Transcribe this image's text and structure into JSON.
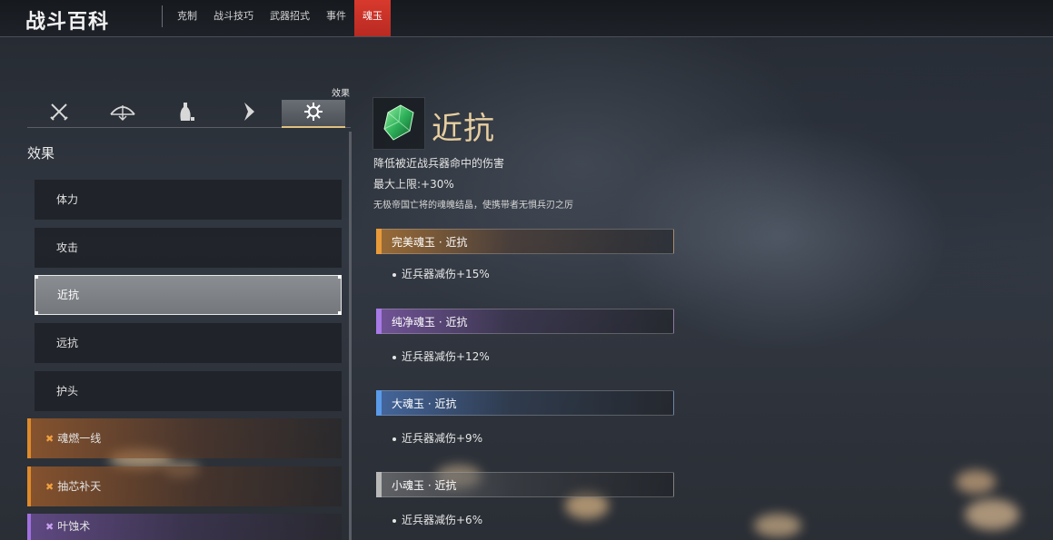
{
  "header": {
    "title": "战斗百科",
    "tabs": [
      {
        "label": "克制"
      },
      {
        "label": "战斗技巧"
      },
      {
        "label": "武器招式"
      },
      {
        "label": "事件"
      },
      {
        "label": "魂玉",
        "active": true
      }
    ]
  },
  "categories": {
    "icons": [
      "crossed-swords-icon",
      "bow-icon",
      "gourd-icon",
      "chevron-mark-icon",
      "effect-emblem-icon"
    ],
    "active_label": "效果"
  },
  "sidebar": {
    "section_title": "效果",
    "items": [
      {
        "label": "体力"
      },
      {
        "label": "攻击"
      },
      {
        "label": "近抗",
        "selected": true
      },
      {
        "label": "远抗"
      },
      {
        "label": "护头"
      },
      {
        "label": "魂燃一线",
        "style": "orange"
      },
      {
        "label": "抽芯补天",
        "style": "orange"
      },
      {
        "label": "叶蚀术",
        "style": "purple"
      }
    ]
  },
  "detail": {
    "title": "近抗",
    "description": "降低被近战兵器命中的伤害",
    "max_limit": "最大上限:+30%",
    "lore": "无极帝国亡将的魂魄结晶，使携带者无惧兵刃之厉",
    "tiers": [
      {
        "name": "完美魂玉 · 近抗",
        "effect": "近兵器减伤+15%",
        "color": "#e89a3a"
      },
      {
        "name": "纯净魂玉 · 近抗",
        "effect": "近兵器减伤+12%",
        "color": "#a77ae6"
      },
      {
        "name": "大魂玉 · 近抗",
        "effect": "近兵器减伤+9%",
        "color": "#5a9ae8"
      },
      {
        "name": "小魂玉 · 近抗",
        "effect": "近兵器减伤+6%",
        "color": "#b8b8b8"
      }
    ]
  },
  "colors": {
    "accent_red": "#d8392d",
    "title_gold": "#e8cfa0"
  }
}
